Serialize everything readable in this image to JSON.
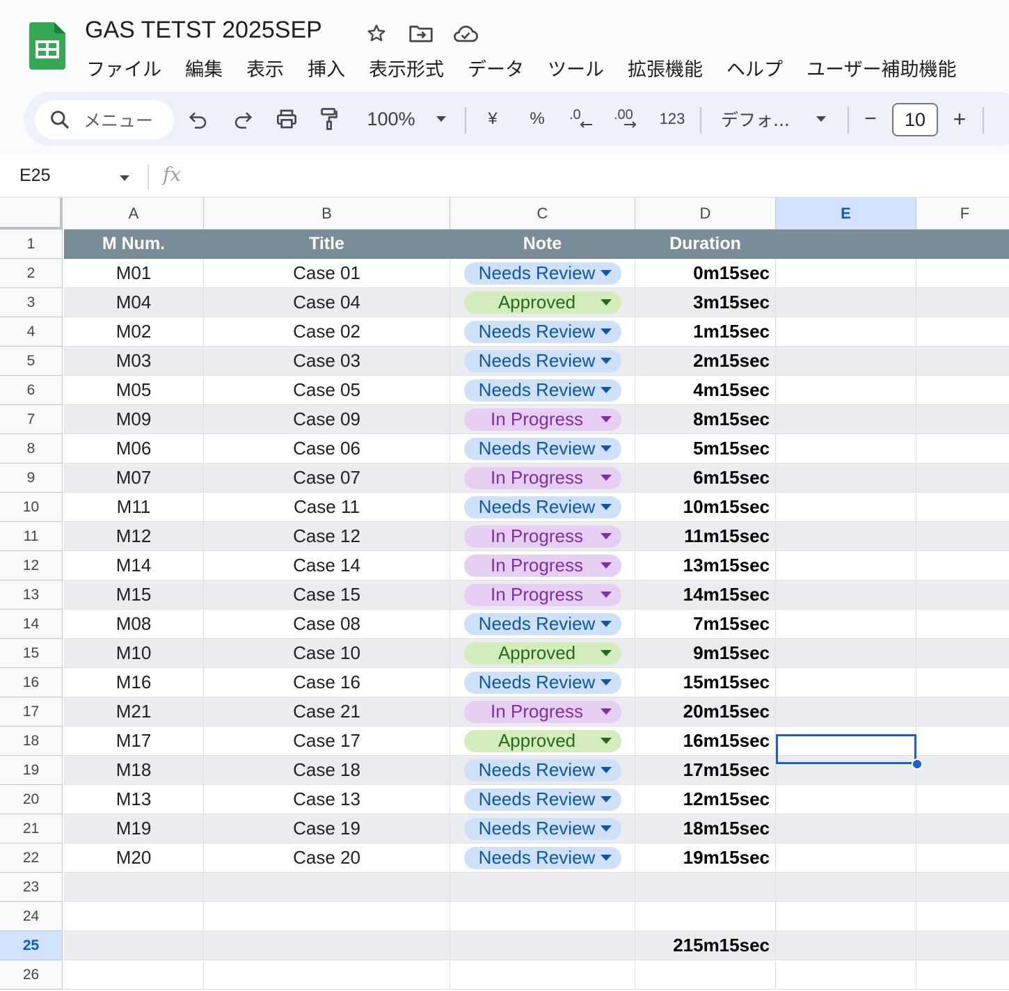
{
  "doc": {
    "title": "GAS TETST 2025SEP",
    "brand_color": "#34a853"
  },
  "title_icons": [
    "star-icon",
    "move-to-folder-icon",
    "cloud-saved-icon"
  ],
  "menu": [
    "ファイル",
    "編集",
    "表示",
    "挿入",
    "表示形式",
    "データ",
    "ツール",
    "拡張機能",
    "ヘルプ",
    "ユーザー補助機能"
  ],
  "toolbar": {
    "search_placeholder": "メニュー",
    "zoom": "100%",
    "currency": "¥",
    "percent": "%",
    "decrease_decimal": ".0",
    "increase_decimal": ".00",
    "number_format": "123",
    "font": "デフォ...",
    "font_size": "10",
    "minus": "−",
    "plus": "+"
  },
  "formula_bar": {
    "cell_ref": "E25",
    "fx": "fx",
    "value": ""
  },
  "columns": [
    "A",
    "B",
    "C",
    "D",
    "E",
    "F"
  ],
  "selected_column": "E",
  "selected_row": "25",
  "header_row": {
    "a": "M Num.",
    "b": "Title",
    "c": "Note",
    "d": "Duration"
  },
  "rows": [
    {
      "n": "2",
      "a": "M01",
      "b": "Case 01",
      "c": "Needs Review",
      "d": "0m15sec"
    },
    {
      "n": "3",
      "a": "M04",
      "b": "Case 04",
      "c": "Approved",
      "d": "3m15sec"
    },
    {
      "n": "4",
      "a": "M02",
      "b": "Case 02",
      "c": "Needs Review",
      "d": "1m15sec"
    },
    {
      "n": "5",
      "a": "M03",
      "b": "Case 03",
      "c": "Needs Review",
      "d": "2m15sec"
    },
    {
      "n": "6",
      "a": "M05",
      "b": "Case 05",
      "c": "Needs Review",
      "d": "4m15sec"
    },
    {
      "n": "7",
      "a": "M09",
      "b": "Case 09",
      "c": "In Progress",
      "d": "8m15sec"
    },
    {
      "n": "8",
      "a": "M06",
      "b": "Case 06",
      "c": "Needs Review",
      "d": "5m15sec"
    },
    {
      "n": "9",
      "a": "M07",
      "b": "Case 07",
      "c": "In Progress",
      "d": "6m15sec"
    },
    {
      "n": "10",
      "a": "M11",
      "b": "Case 11",
      "c": "Needs Review",
      "d": "10m15sec"
    },
    {
      "n": "11",
      "a": "M12",
      "b": "Case 12",
      "c": "In Progress",
      "d": "11m15sec"
    },
    {
      "n": "12",
      "a": "M14",
      "b": "Case 14",
      "c": "In Progress",
      "d": "13m15sec"
    },
    {
      "n": "13",
      "a": "M15",
      "b": "Case 15",
      "c": "In Progress",
      "d": "14m15sec"
    },
    {
      "n": "14",
      "a": "M08",
      "b": "Case 08",
      "c": "Needs Review",
      "d": "7m15sec"
    },
    {
      "n": "15",
      "a": "M10",
      "b": "Case 10",
      "c": "Approved",
      "d": "9m15sec"
    },
    {
      "n": "16",
      "a": "M16",
      "b": "Case 16",
      "c": "Needs Review",
      "d": "15m15sec"
    },
    {
      "n": "17",
      "a": "M21",
      "b": "Case 21",
      "c": "In Progress",
      "d": "20m15sec"
    },
    {
      "n": "18",
      "a": "M17",
      "b": "Case 17",
      "c": "Approved",
      "d": "16m15sec"
    },
    {
      "n": "19",
      "a": "M18",
      "b": "Case 18",
      "c": "Needs Review",
      "d": "17m15sec"
    },
    {
      "n": "20",
      "a": "M13",
      "b": "Case 13",
      "c": "Needs Review",
      "d": "12m15sec"
    },
    {
      "n": "21",
      "a": "M19",
      "b": "Case 19",
      "c": "Needs Review",
      "d": "18m15sec"
    },
    {
      "n": "22",
      "a": "M20",
      "b": "Case 20",
      "c": "Needs Review",
      "d": "19m15sec"
    },
    {
      "n": "23",
      "a": "",
      "b": "",
      "c": "",
      "d": ""
    },
    {
      "n": "24",
      "a": "",
      "b": "",
      "c": "",
      "d": ""
    },
    {
      "n": "25",
      "a": "",
      "b": "",
      "c": "",
      "d": "215m15sec"
    },
    {
      "n": "26",
      "a": "",
      "b": "",
      "c": "",
      "d": ""
    }
  ],
  "row1_num": "1",
  "status_colors": {
    "Needs Review": "#cfe1f8",
    "Approved": "#d4edbc",
    "In Progress": "#e6cff2"
  },
  "header_bg": "#7b8c99",
  "selection_color": "#1a5fcf"
}
